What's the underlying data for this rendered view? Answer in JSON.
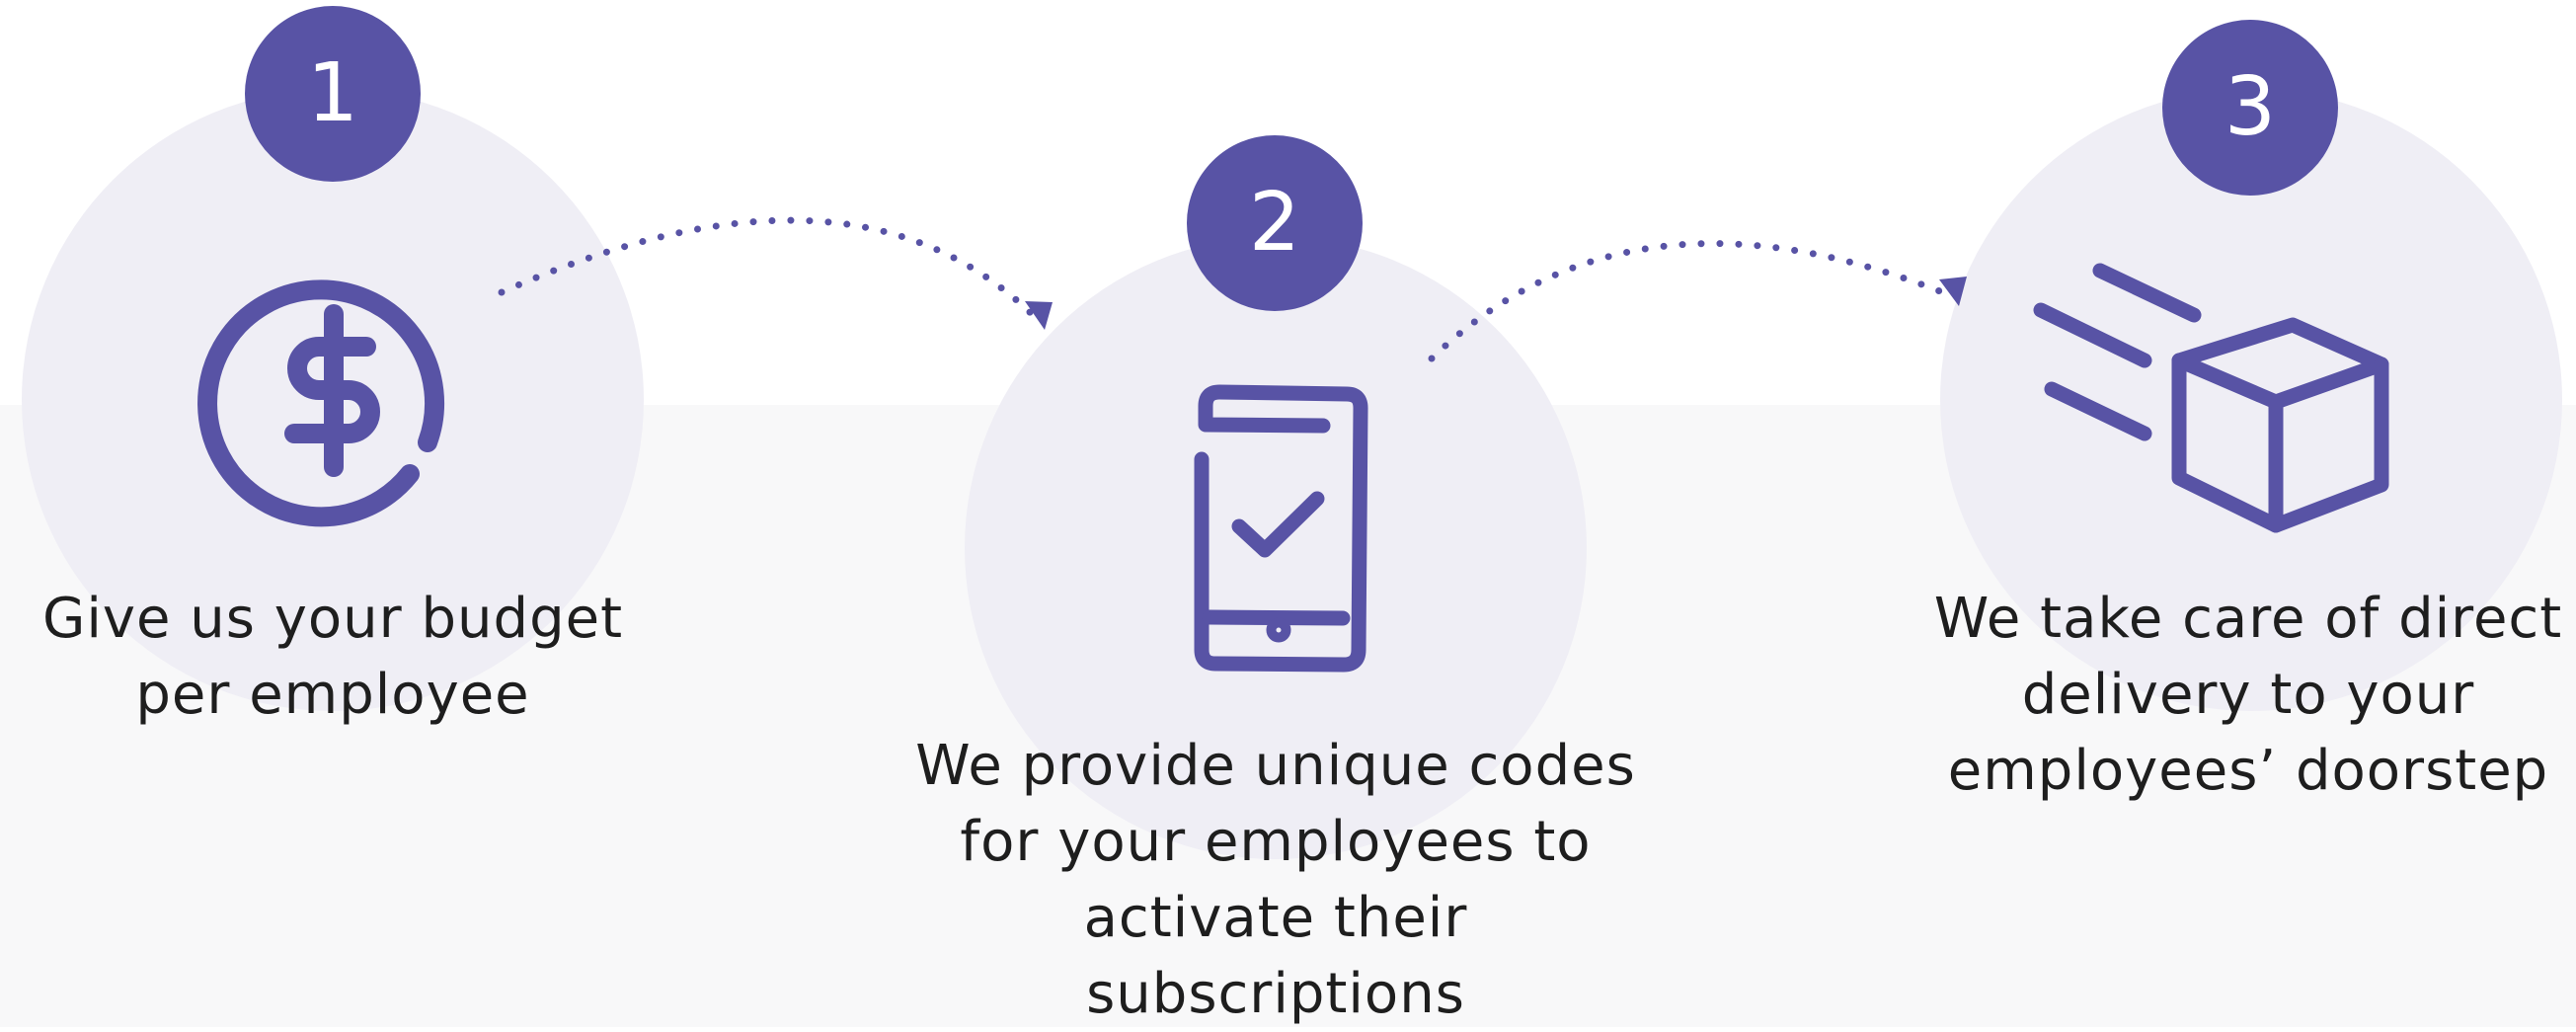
{
  "colors": {
    "accent": "#5853a5",
    "circle_fill": "#efeef5",
    "band": "#f8f8f9",
    "text": "#1e1e1e"
  },
  "steps": [
    {
      "number": "1",
      "icon": "dollar-coin-icon",
      "lines": [
        "Give us your budget",
        "per employee"
      ]
    },
    {
      "number": "2",
      "icon": "phone-checkmark-icon",
      "lines": [
        "We provide unique codes",
        "for your employees to",
        "activate their",
        "subscriptions"
      ]
    },
    {
      "number": "3",
      "icon": "delivery-box-icon",
      "lines": [
        "We take care of direct",
        "delivery to your",
        "employees’ doorstep"
      ]
    }
  ]
}
